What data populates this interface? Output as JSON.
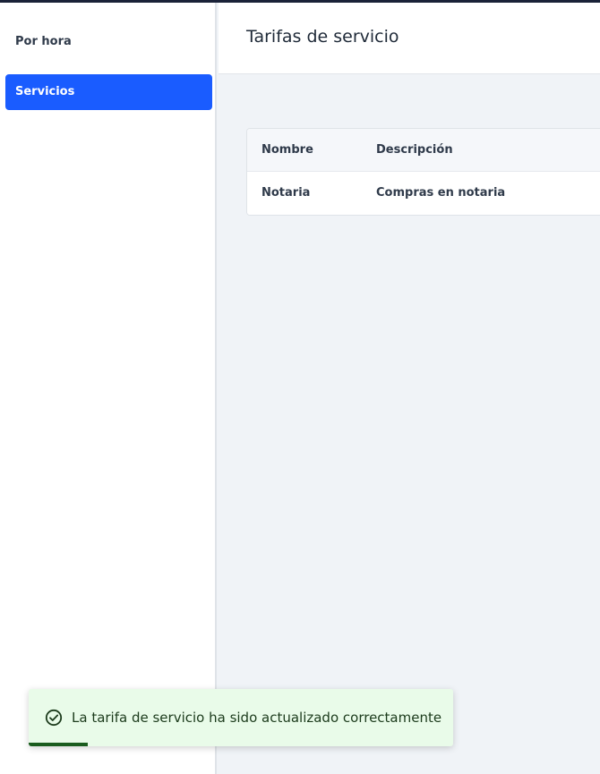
{
  "sidebar": {
    "items": [
      {
        "label": "Por hora",
        "active": false
      },
      {
        "label": "Servicios",
        "active": true
      }
    ]
  },
  "header": {
    "title": "Tarifas de servicio"
  },
  "table": {
    "columns": [
      "Nombre",
      "Descripción"
    ],
    "rows": [
      [
        "Notaria",
        "Compras en notaria"
      ]
    ]
  },
  "toast": {
    "icon": "check-circle-icon",
    "message": "La tarifa de servicio ha sido actualizado correctamente",
    "progress": 0.14
  },
  "colors": {
    "accent": "#1a5cff",
    "toast_bg": "#e9fbe9",
    "toast_progress": "#1a5c1e"
  }
}
